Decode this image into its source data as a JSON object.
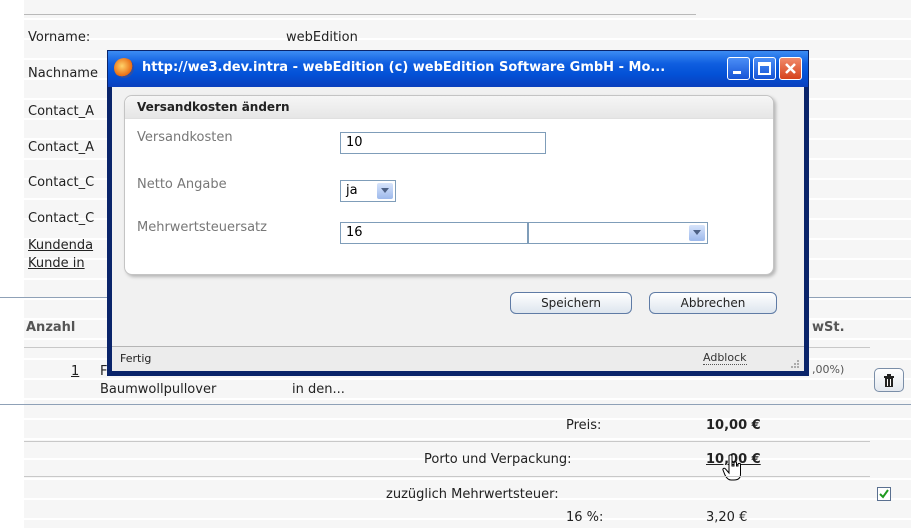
{
  "background": {
    "labels": {
      "vorname": "Vorname:",
      "vorname_value": "webEdition",
      "nachname": "Nachname",
      "contact1": "Contact_A",
      "contact2": "Contact_A",
      "contact3": "Contact_C",
      "contact4": "Contact_C",
      "kundendaten": "Kundenda",
      "kunde_in": "Kunde in"
    },
    "table": {
      "col_anzahl": "Anzahl",
      "col_mwst": "wSt.",
      "item_qty": "1",
      "item_prefix": "F",
      "item_name": "Baumwollpullover",
      "item_desc": "in den...",
      "item_vat": ",00%)"
    },
    "totals": {
      "preis_label": "Preis:",
      "preis_value": "10,00 €",
      "porto_label": "Porto und Verpackung:",
      "porto_value": "10,00 €",
      "mwst_label": "zuzüglich Mehrwertsteuer:",
      "mwst_rate": "16 %:",
      "mwst_value": "3,20 €"
    }
  },
  "popup": {
    "window_title": "http://we3.dev.intra - webEdition (c) webEdition Software GmbH - Mo...",
    "section_title": "Versandkosten ändern",
    "fields": {
      "versandkosten_label": "Versandkosten",
      "versandkosten_value": "10",
      "netto_label": "Netto Angabe",
      "netto_value": "ja",
      "mwst_label": "Mehrwertsteuersatz",
      "mwst_value": "16"
    },
    "buttons": {
      "save": "Speichern",
      "cancel": "Abbrechen"
    },
    "status": {
      "left": "Fertig",
      "right": "Adblock"
    }
  }
}
